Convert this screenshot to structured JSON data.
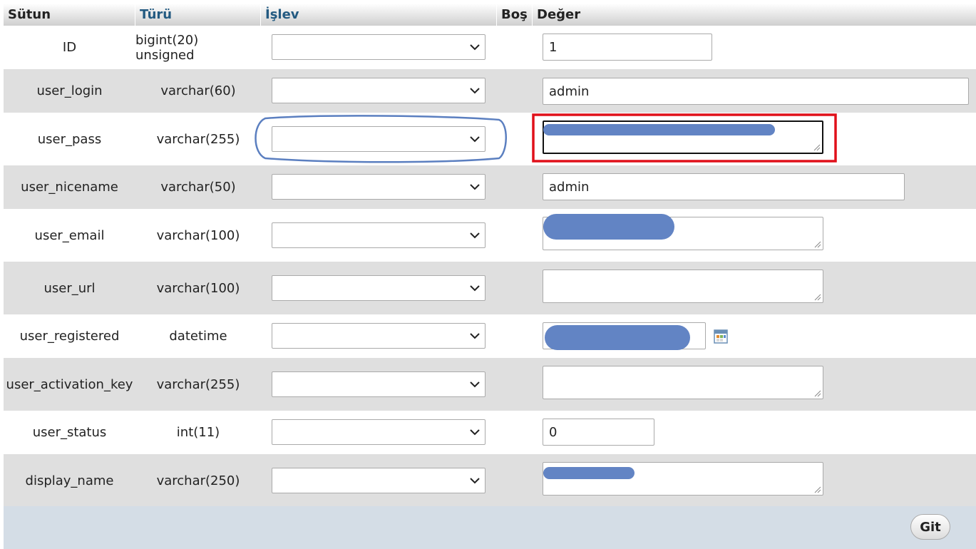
{
  "header": {
    "column": "Sütun",
    "type": "Türü",
    "function": "İşlev",
    "null": "Boş",
    "value": "Değer"
  },
  "rows": [
    {
      "name": "ID",
      "type": "bigint(20) unsigned",
      "value": "1"
    },
    {
      "name": "user_login",
      "type": "varchar(60)",
      "value": "admin"
    },
    {
      "name": "user_pass",
      "type": "varchar(255)",
      "value": ""
    },
    {
      "name": "user_nicename",
      "type": "varchar(50)",
      "value": "admin"
    },
    {
      "name": "user_email",
      "type": "varchar(100)",
      "value": ""
    },
    {
      "name": "user_url",
      "type": "varchar(100)",
      "value": ""
    },
    {
      "name": "user_registered",
      "type": "datetime",
      "value": ""
    },
    {
      "name": "user_activation_key",
      "type": "varchar(255)",
      "value": ""
    },
    {
      "name": "user_status",
      "type": "int(11)",
      "value": "0"
    },
    {
      "name": "display_name",
      "type": "varchar(250)",
      "value": ""
    }
  ],
  "footer": {
    "go_label": "Git"
  },
  "colors": {
    "row_alt": "#dfdfdf",
    "header_link": "#235a81",
    "annotation_blue": "#5b7fc0",
    "annotation_red": "#e0101a",
    "redaction": "#6284c4",
    "footer_bg": "#d4dde6"
  },
  "icons": {
    "calendar": "calendar-icon",
    "dropdown": "chevron-down-icon",
    "resize": "resize-grip-icon"
  }
}
